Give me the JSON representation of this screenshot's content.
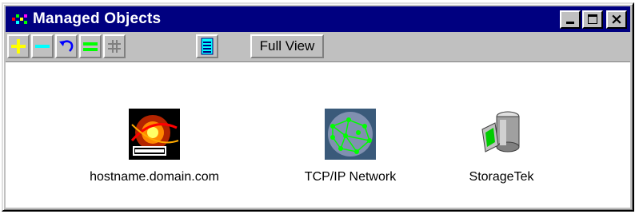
{
  "window": {
    "title": "Managed Objects",
    "controls": {
      "minimize": "minimize",
      "maximize": "maximize",
      "close": "close"
    }
  },
  "toolbar": {
    "buttons": [
      {
        "name": "add",
        "icon": "plus-icon",
        "color": "#ffff00"
      },
      {
        "name": "remove",
        "icon": "minus-icon",
        "color": "#00ffff"
      },
      {
        "name": "undo",
        "icon": "undo-icon",
        "color": "#0000ff"
      },
      {
        "name": "equal",
        "icon": "equals-icon",
        "color": "#00ff00"
      },
      {
        "name": "grid",
        "icon": "grid-icon",
        "color": "#808080"
      },
      {
        "name": "list",
        "icon": "list-icon",
        "color": "#00ffff"
      }
    ],
    "view_label": "Full View"
  },
  "objects": [
    {
      "label": "hostname.domain.com",
      "icon": "host-computer-icon"
    },
    {
      "label": "TCP/IP Network",
      "icon": "network-globe-icon"
    },
    {
      "label": "StorageTek",
      "icon": "storage-device-icon"
    }
  ],
  "colors": {
    "titlebar": "#000080",
    "window_face": "#c0c0c0",
    "content_bg": "#ffffff"
  }
}
